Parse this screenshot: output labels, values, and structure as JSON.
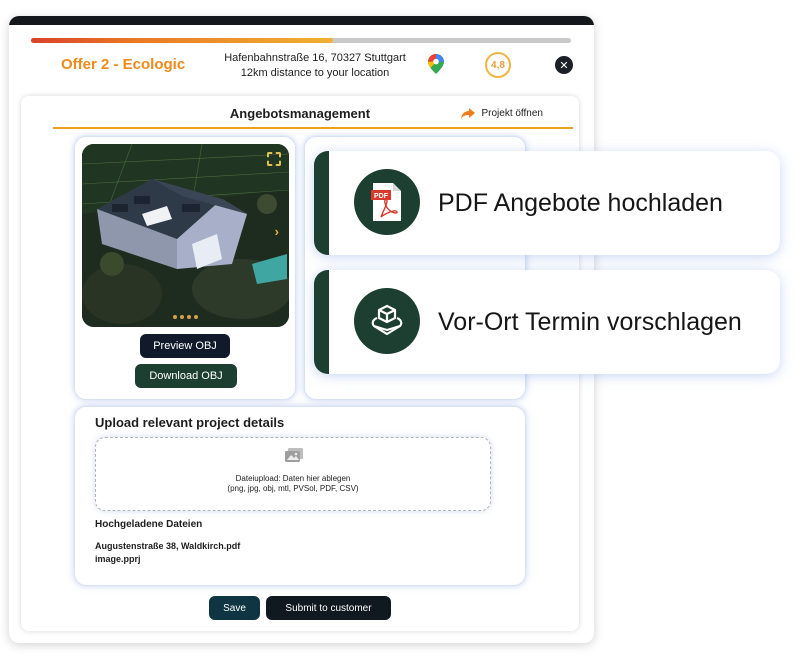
{
  "header": {
    "offer_title": "Offer 2 - Ecologic",
    "address": "Hafenbahnstraße 16, 70327 Stuttgart",
    "distance": "12km distance to your location",
    "rating": "4,8",
    "close_icon": "✕",
    "progress_percent": 56
  },
  "management": {
    "title": "Angebotsmanagement",
    "project_open_label": "Projekt öffnen"
  },
  "media": {
    "preview_label": "Preview OBJ",
    "download_label": "Download OBJ",
    "slide_count": 4
  },
  "upload": {
    "title": "Upload relevant project details",
    "drop_line1": "Dateiupload: Daten hier ablegen",
    "drop_line2": "(png, jpg, obj, mtl, PVSol, PDF, CSV)",
    "uploaded_title": "Hochgeladene Dateien",
    "files": [
      "Augustenstraße 38, Waldkirch.pdf",
      "image.pprj"
    ]
  },
  "footer": {
    "save_label": "Save",
    "submit_label": "Submit to customer"
  },
  "actions": [
    {
      "label": "PDF Angebote  hochladen",
      "icon": "pdf-icon"
    },
    {
      "label": "Vor-Ort Termin vorschlagen",
      "icon": "cube-icon"
    }
  ],
  "colors": {
    "accent_orange": "#f08a1c",
    "dark_green": "#1d3f31",
    "navy": "#101a2a"
  }
}
